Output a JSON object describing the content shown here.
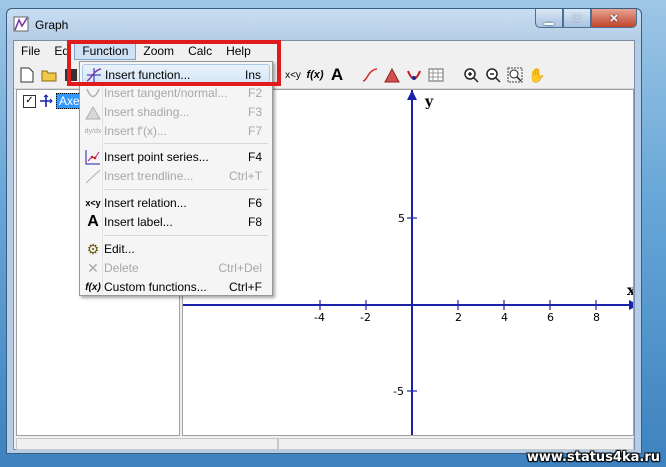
{
  "window": {
    "title": "Graph"
  },
  "menubar": {
    "items": [
      {
        "label": "File"
      },
      {
        "label": "Edit"
      },
      {
        "label": "Function"
      },
      {
        "label": "Zoom"
      },
      {
        "label": "Calc"
      },
      {
        "label": "Help"
      }
    ],
    "edit_visible": "Edi"
  },
  "tree": {
    "item_label": "Axes",
    "checked": true
  },
  "function_menu": {
    "items": [
      {
        "label": "Insert function...",
        "shortcut": "Ins",
        "enabled": true,
        "icon": "insert-function-icon"
      },
      {
        "label": "Insert tangent/normal...",
        "shortcut": "F2",
        "enabled": false,
        "icon": "tangent-icon"
      },
      {
        "label": "Insert shading...",
        "shortcut": "F3",
        "enabled": false,
        "icon": "shading-icon"
      },
      {
        "label": "Insert f'(x)...",
        "shortcut": "F7",
        "enabled": false,
        "icon": "derivative-icon"
      },
      {
        "label": "Insert point series...",
        "shortcut": "F4",
        "enabled": true,
        "icon": "point-series-icon"
      },
      {
        "label": "Insert trendline...",
        "shortcut": "Ctrl+T",
        "enabled": false,
        "icon": "trendline-icon"
      },
      {
        "label": "Insert relation...",
        "shortcut": "F6",
        "enabled": true,
        "icon": "relation-icon"
      },
      {
        "label": "Insert label...",
        "shortcut": "F8",
        "enabled": true,
        "icon": "label-icon"
      },
      {
        "label": "Edit...",
        "shortcut": "",
        "enabled": true,
        "icon": "edit-gears-icon"
      },
      {
        "label": "Delete",
        "shortcut": "Ctrl+Del",
        "enabled": false,
        "icon": "delete-icon"
      },
      {
        "label": "Custom functions...",
        "shortcut": "Ctrl+F",
        "enabled": true,
        "icon": "custom-functions-icon"
      }
    ],
    "icon_text": {
      "derivative": "dy/dx",
      "relation": "x<y",
      "label": "A",
      "custom": "f(x)"
    }
  },
  "toolbar": {
    "relation_text": "x<y",
    "function_text": "f(x)",
    "label_text": "A"
  },
  "graph": {
    "x_axis_label": "x",
    "y_axis_label": "y",
    "x_ticks": [
      "-4",
      "-2",
      "2",
      "4",
      "6",
      "8"
    ],
    "y_ticks": [
      "5",
      "-5"
    ],
    "axis_color": "#1a23a8"
  },
  "watermark": "www.status4ka.ru",
  "colors": {
    "highlight_box": "#e01b1b",
    "selection": "#3399ff"
  }
}
